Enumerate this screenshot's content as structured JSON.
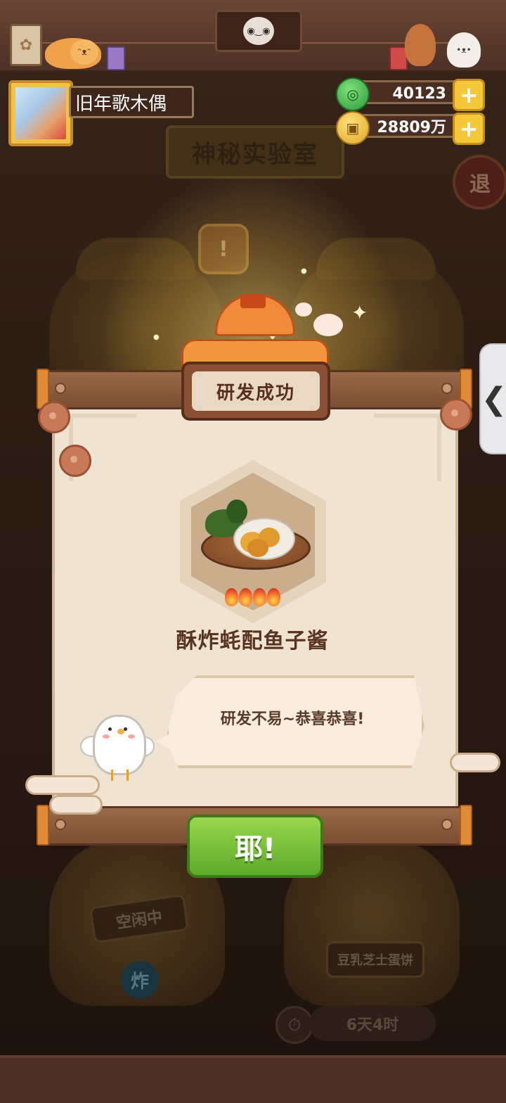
{
  "background": {
    "lab_title": "神秘实验室",
    "exit_label": "退",
    "idle_label": "空闲中",
    "fry_badge": "炸",
    "recipe_badge": "豆乳芝士蛋饼",
    "timer_text": "6天4时"
  },
  "player": {
    "name": "旧年歌木偶"
  },
  "currency": {
    "jade_value": "40123",
    "coin_value": "28809万",
    "plus_label": "+"
  },
  "side_tab": {
    "arrow": "❮"
  },
  "dialog": {
    "title": "研发成功",
    "dish_name": "酥炸蚝配鱼子酱",
    "heat_level": 4,
    "message": "研发不易~恭喜恭喜!",
    "confirm_label": "耶!"
  },
  "colors": {
    "confirm_green": "#5caa2a",
    "plaque_brown": "#8a5034",
    "paper": "#efe4d2"
  }
}
